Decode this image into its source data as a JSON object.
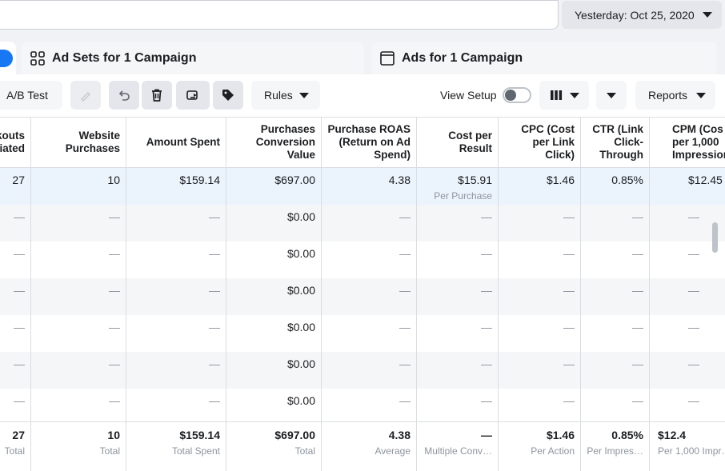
{
  "date_range": {
    "label": "Yesterday: Oct 25, 2020"
  },
  "tabs": {
    "adsets": "Ad Sets for 1 Campaign",
    "ads": "Ads for 1 Campaign"
  },
  "toolbar": {
    "ab_test": "A/B Test",
    "rules": "Rules",
    "view_setup": "View Setup",
    "reports": "Reports"
  },
  "columns": [
    "kouts\niated",
    "Website\nPurchases",
    "Amount Spent",
    "Purchases\nConversion\nValue",
    "Purchase ROAS\n(Return on Ad\nSpend)",
    "Cost per\nResult",
    "CPC (Cost\nper Link\nClick)",
    "CTR (Link\nClick-\nThrough",
    "CPM (Cos\nper 1,000\nImpressions"
  ],
  "rows": [
    {
      "c": [
        "27",
        "10",
        "$159.14",
        "$697.00",
        "4.38",
        "$15.91",
        "$1.46",
        "0.85%",
        "$12.45"
      ],
      "sub5": "Per Purchase"
    },
    {
      "c": [
        "—",
        "—",
        "—",
        "$0.00",
        "—",
        "—",
        "—",
        "—",
        "—"
      ]
    },
    {
      "c": [
        "—",
        "—",
        "—",
        "$0.00",
        "—",
        "—",
        "—",
        "—",
        "—"
      ]
    },
    {
      "c": [
        "—",
        "—",
        "—",
        "$0.00",
        "—",
        "—",
        "—",
        "—",
        "—"
      ]
    },
    {
      "c": [
        "—",
        "—",
        "—",
        "$0.00",
        "—",
        "—",
        "—",
        "—",
        "—"
      ]
    },
    {
      "c": [
        "—",
        "—",
        "—",
        "$0.00",
        "—",
        "—",
        "—",
        "—",
        "—"
      ]
    },
    {
      "c": [
        "—",
        "—",
        "—",
        "$0.00",
        "—",
        "—",
        "—",
        "—",
        "—"
      ]
    }
  ],
  "totals": {
    "values": [
      "27",
      "10",
      "$159.14",
      "$697.00",
      "4.38",
      "—",
      "$1.46",
      "0.85%",
      "$12.4"
    ],
    "labels": [
      "Total",
      "Total",
      "Total Spent",
      "Total",
      "Average",
      "Multiple Conv…",
      "Per Action",
      "Per Impres…",
      "Per 1,000 Impr…"
    ]
  }
}
